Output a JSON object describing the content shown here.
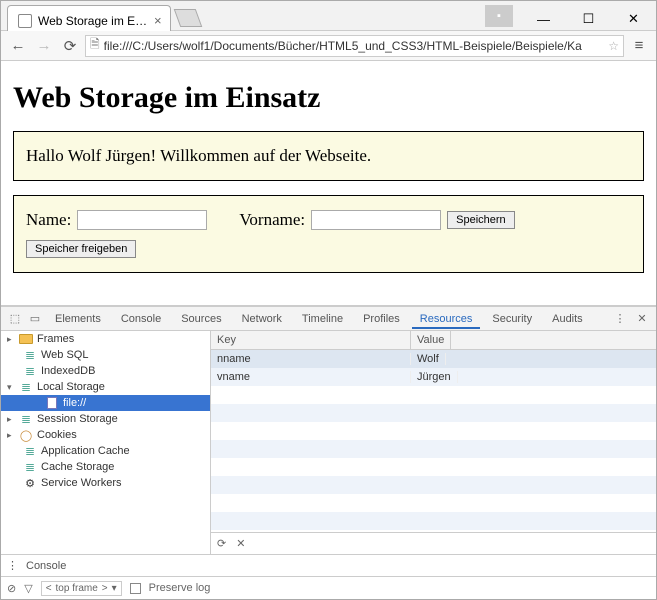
{
  "window": {
    "tab_title": "Web Storage im Eins",
    "url": "file:///C:/Users/wolf1/Documents/Bücher/HTML5_und_CSS3/HTML-Beispiele/Beispiele/Ka"
  },
  "page": {
    "heading": "Web Storage im Einsatz",
    "greeting": "Hallo Wolf Jürgen! Willkommen auf der Webseite.",
    "label_name": "Name:",
    "label_vorname": "Vorname:",
    "btn_save": "Speichern",
    "btn_clear": "Speicher freigeben"
  },
  "devtools": {
    "tabs": [
      "Elements",
      "Console",
      "Sources",
      "Network",
      "Timeline",
      "Profiles",
      "Resources",
      "Security",
      "Audits"
    ],
    "active_tab": "Resources",
    "tree": {
      "frames": "Frames",
      "websql": "Web SQL",
      "indexeddb": "IndexedDB",
      "localstorage": "Local Storage",
      "ls_file": "file://",
      "sessionstorage": "Session Storage",
      "cookies": "Cookies",
      "appcache": "Application Cache",
      "cachestorage": "Cache Storage",
      "serviceworkers": "Service Workers"
    },
    "table": {
      "col_key": "Key",
      "col_value": "Value",
      "rows": [
        {
          "key": "nname",
          "value": "Wolf"
        },
        {
          "key": "vname",
          "value": "Jürgen"
        }
      ]
    },
    "drawer": {
      "tab": "Console",
      "frame": "top frame",
      "preserve": "Preserve log"
    }
  }
}
